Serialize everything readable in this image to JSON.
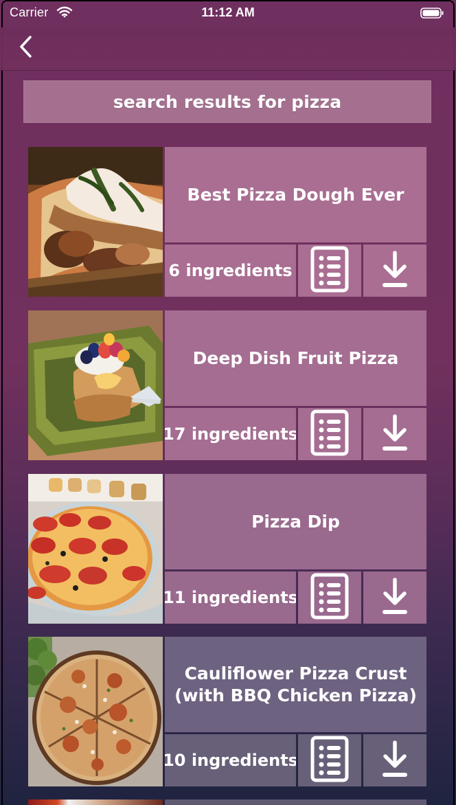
{
  "status_bar": {
    "carrier": "Carrier",
    "time": "11:12 AM"
  },
  "nav": {
    "back_icon": "chevron-left-icon"
  },
  "search": {
    "header": "search results for pizza"
  },
  "recipes": [
    {
      "title": "Best Pizza Dough Ever",
      "ingredients": "6 ingredients",
      "image": "pizza-dough-photo",
      "list_icon": "list-icon",
      "download_icon": "download-icon"
    },
    {
      "title": "Deep Dish Fruit Pizza",
      "ingredients": "17 ingredients",
      "image": "fruit-pizza-photo",
      "list_icon": "list-icon",
      "download_icon": "download-icon"
    },
    {
      "title": "Pizza Dip",
      "ingredients": "11 ingredients",
      "image": "pizza-dip-photo",
      "list_icon": "list-icon",
      "download_icon": "download-icon"
    },
    {
      "title": "Cauliflower Pizza Crust (with BBQ Chicken Pizza)",
      "ingredients": "10 ingredients",
      "image": "cauliflower-pizza-photo",
      "list_icon": "list-icon",
      "download_icon": "download-icon"
    }
  ],
  "colors": {
    "background_top": "#6f2f5f",
    "background_bottom": "#1f2440",
    "card_fill": "#a86f92",
    "text": "#ffffff"
  }
}
